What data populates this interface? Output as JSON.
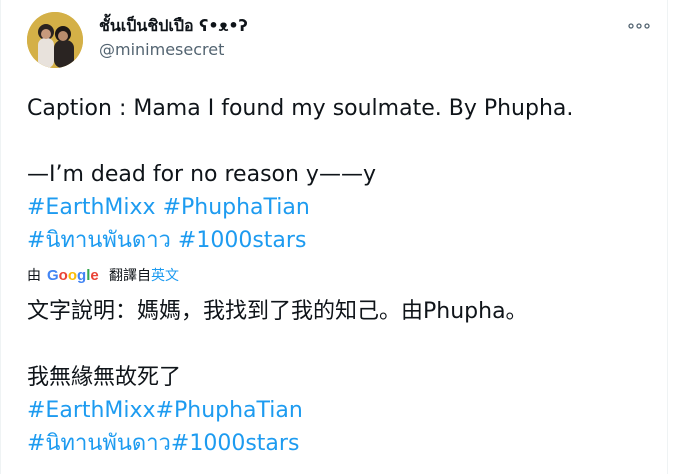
{
  "user": {
    "display_name": "ชั้นเป็นชิปเปือ ʕ•ᴥ•ʔ",
    "handle": "@minimesecret"
  },
  "tweet": {
    "caption": "Caption : Mama I found my soulmate. By Phupha.",
    "line2": "—I’m dead for no reason y——y",
    "hashtags_1": [
      "#EarthMixx",
      "#PhuphaTian"
    ],
    "hashtags_2": [
      "#นิทานพันดาว",
      "#1000stars"
    ]
  },
  "translation_bar": {
    "by_label": "由",
    "provider": "Google",
    "translated_from": "翻譯自",
    "language_link": "英文"
  },
  "translated": {
    "line1": "文字說明：媽媽，我找到了我的知己。由Phupha。",
    "line2": "我無緣無故死了",
    "hashtags_1": "#EarthMixx#PhuphaTian",
    "hashtags_2": "#นิทานพันดาว#1000stars"
  },
  "colors": {
    "link": "#1d9bf0",
    "text": "#0f1419",
    "secondary": "#536471"
  },
  "icons": {
    "more": "more-horizontal-icon",
    "avatar": "user-avatar"
  }
}
